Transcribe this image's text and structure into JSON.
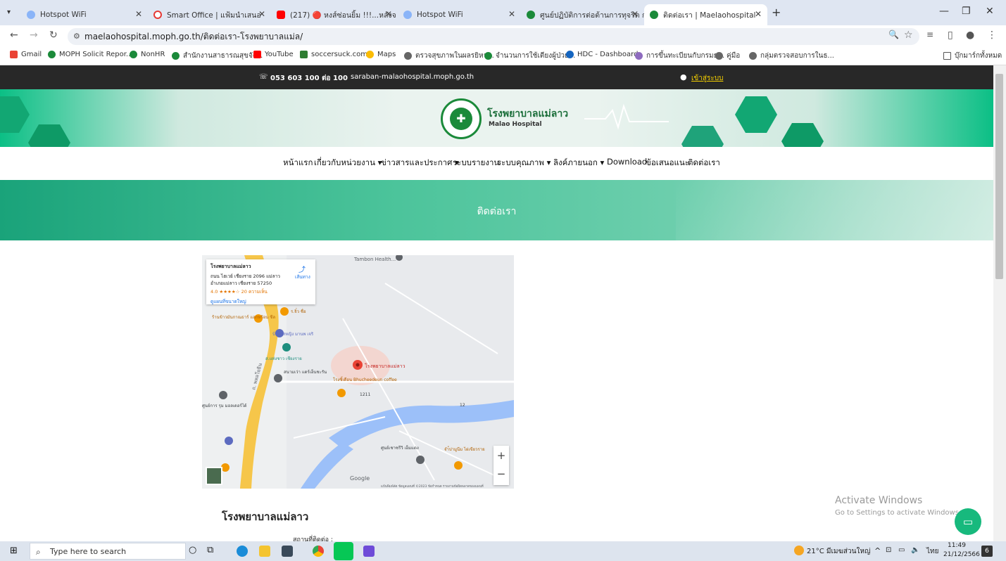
{
  "tabs": [
    {
      "title": "Hotspot WiFi",
      "color": "#8ab4f8"
    },
    {
      "title": "Smart Office | แฟ้มนำเสนอ",
      "color": "#e53935"
    },
    {
      "title": "(217) 🔴 หงส์ซ่อนยิ้ม !!!...หลังจ 🔊",
      "color": "#ff0000"
    },
    {
      "title": "Hotspot WiFi",
      "color": "#8ab4f8"
    },
    {
      "title": "ศูนย์ปฏิบัติการต่อต้านการทุจริต กระ",
      "color": "#1b8a3a"
    },
    {
      "title": "ติดต่อเรา | Maelaohospital",
      "color": "#1b8a3a"
    }
  ],
  "address": {
    "url": "maelaohospital.moph.go.th/ติดต่อเรา-โรงพยาบาลแม่ล/"
  },
  "bookmarks": [
    "Gmail",
    "MOPH Solicit Repor...",
    "NonHR",
    "สำนักงานสาธารณสุขจัง...",
    "YouTube",
    "soccersuck.com",
    "Maps",
    "ตรวจสุขภาพในผลรยิหา...",
    "จำนวนการใช้เตียงผู้ป่วย...",
    "HDC - Dashboard",
    "การขึ้นทะเบียนกับกรมธ...",
    "คู่มือ",
    "กลุ่มตรวจสอบการในธ..."
  ],
  "bookmarks_folder": "บุ๊กมาร์กทั้งหมด",
  "topbar": {
    "phone": "053 603 100 ต่อ 100",
    "email": "saraban-malaohospital.moph.go.th",
    "login": "เข้าสู่ระบบ"
  },
  "brand": {
    "name_th": "โรงพยาบาลแม่ลาว",
    "name_en": "Malao Hospital"
  },
  "menu": [
    "หน้าแรก",
    "เกี่ยวกับหน่วยงาน ▾",
    "ข่าวสารและประกาศ ▾",
    "ระบบรายงาน",
    "ระบบคุณภาพ ▾",
    "ลิงค์ภายนอก ▾",
    "Download",
    "ข้อเสนอแนะ",
    "ติดต่อเรา"
  ],
  "hero_title": "ติดต่อเรา",
  "map": {
    "card_title": "โรงพยาบาลแม่ลาว",
    "card_addr": "ถนน ไฮเวย์ เชียงราย 2096 แม่ลาว",
    "card_addr2": "อำเภอแม่ลาว เชียงราย 57250",
    "card_rating": "4.0 ★★★★☆ 20 ความเห็น",
    "card_link": "ดูแผนที่ขนาดใหญ่",
    "card_dir": "เส้นทาง",
    "pin_label": "โรงพยาบาลแม่ลาว",
    "labels": [
      "Tambon Health...",
      "บ้านรสหญิง มานพ เจริ",
      "ร.จิ๋ว ชื่อ",
      "ส.แห่งชาว เชียงราย",
      "สนามเว่า แดร์เอ็นชะรัน",
      "ร้านข้าวมันกาณธาร์ แลกหร้อน ชีล",
      "โรงซิ้เดือน Bhucheedeun coffee",
      "ศูนย์การ รุม มอลเดอร์ได้",
      "ศูนย์เชาซรีวิ เอ็มแดง",
      "จำ้ปามูนีม ไผ่เขียวราย",
      "1211",
      "12",
      "Google"
    ],
    "road_label": "ถ. พหลโยธิน",
    "attribution": "แป้นพิมพ์ลัด ข้อมูลแผนที่ ©2023 ข้อกำหนด รายงานข้อผิดพลาดของแผนที่",
    "zoom_in": "+",
    "zoom_out": "−"
  },
  "hospital_name": "โรงพยาบาลแม่ลาว",
  "contact_label": "สถานที่ติดต่อ :",
  "activate": {
    "line1": "Activate Windows",
    "line2": "Go to Settings to activate Windows."
  },
  "taskbar": {
    "search": "Type here to search",
    "weather": "21°C มีเมฆส่วนใหญ่",
    "lang": "ไทย",
    "time": "11:49",
    "date": "21/12/2566",
    "notif": "6"
  }
}
